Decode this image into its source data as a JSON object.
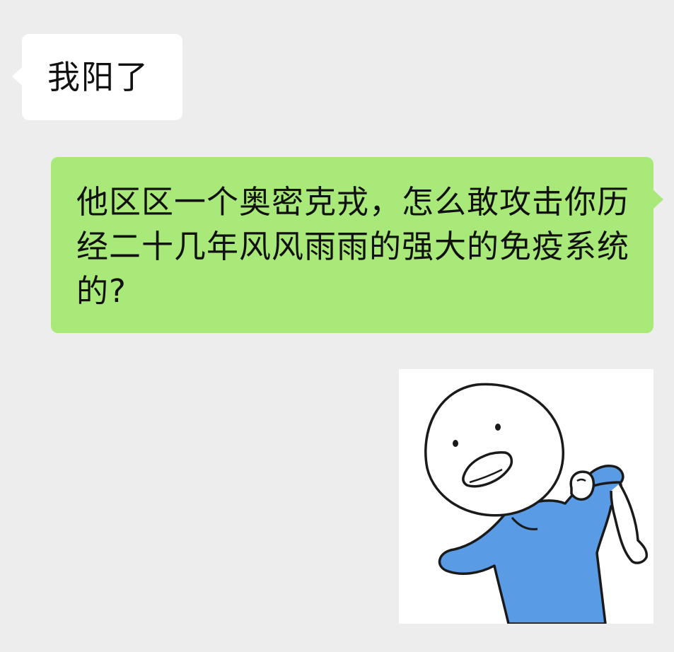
{
  "conversation": {
    "messages": [
      {
        "side": "left",
        "type": "text",
        "text": "我阳了"
      },
      {
        "side": "right",
        "type": "text",
        "text": "他区区一个奥密克戎，怎么敢攻击你历经二十几年风风雨雨的强大的免疫系统的?"
      },
      {
        "side": "right",
        "type": "sticker",
        "sticker_icon": "laughing-stickman-icon"
      }
    ]
  },
  "colors": {
    "background": "#ededed",
    "incoming_bubble": "#ffffff",
    "outgoing_bubble": "#a9e97a",
    "sticker_shirt": "#5a9be5"
  }
}
